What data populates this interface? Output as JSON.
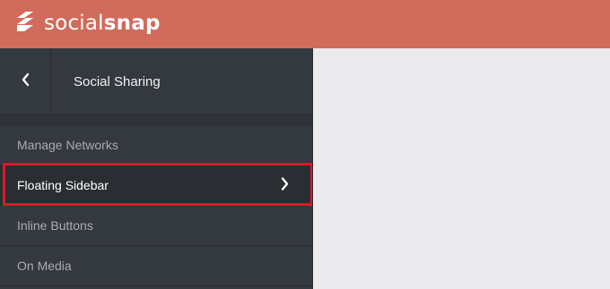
{
  "brand": {
    "name_light": "social",
    "name_bold": "snap",
    "mark_icon": "socialsnap-logo-icon"
  },
  "panel": {
    "title": "Social Sharing",
    "back_icon": "chevron-left-icon"
  },
  "menu": [
    {
      "label": "Manage Networks",
      "active": false
    },
    {
      "label": "Floating Sidebar",
      "active": true,
      "icon": "chevron-right-icon"
    },
    {
      "label": "Inline Buttons",
      "active": false
    },
    {
      "label": "On Media",
      "active": false
    }
  ],
  "colors": {
    "header": "#d16b5c",
    "sidebar": "#34383f",
    "active_item": "#2a2d32",
    "highlight_border": "#e0162b",
    "content": "#ebebee"
  }
}
